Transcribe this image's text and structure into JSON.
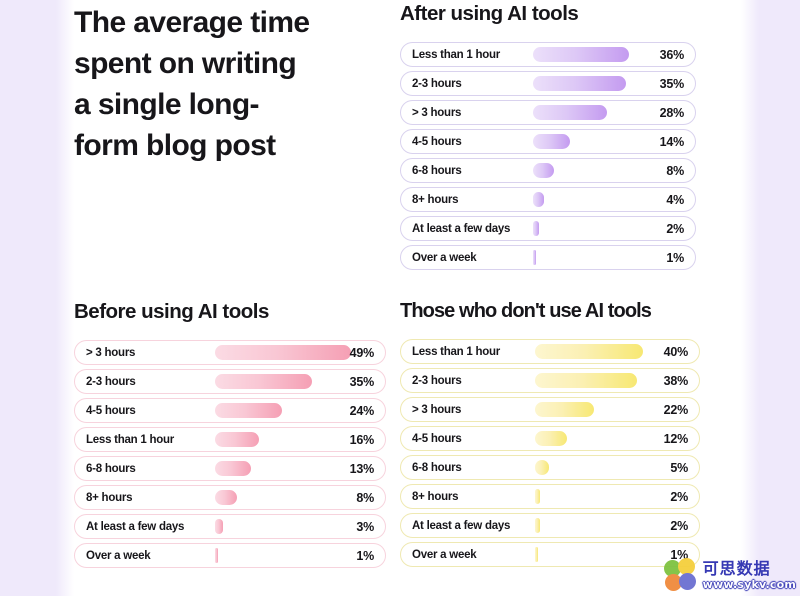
{
  "headline": "The average time spent on writing a single long-form blog post",
  "headline_lines": "The average time\nspent on writing\na single long-\nform blog post",
  "colors": {
    "purple_accent": "#c49bf0",
    "pink_accent": "#f59fb4",
    "yellow_accent": "#f7e873",
    "page_background": "#ffffff",
    "gutter_background": "#efe9fb",
    "text": "#17161a"
  },
  "sections": {
    "after": {
      "title": "After using AI tools",
      "color": "purple"
    },
    "before": {
      "title": "Before using AI tools",
      "color": "pink"
    },
    "non_users": {
      "title": "Those who don't use AI tools",
      "color": "yellow"
    }
  },
  "watermark": {
    "cn": "可思数据",
    "url": "www.sykv.com"
  },
  "chart_data": [
    {
      "type": "bar",
      "title": "After using AI tools",
      "orientation": "horizontal",
      "series_color": "#c49bf0",
      "xlabel": "",
      "ylabel": "",
      "xlim": [
        0,
        100
      ],
      "unit": "%",
      "grid": false,
      "legend": "none",
      "categories": [
        "Less than 1 hour",
        "2-3 hours",
        "> 3 hours",
        "4-5 hours",
        "6-8 hours",
        "8+ hours",
        "At least a few days",
        "Over a week"
      ],
      "values": [
        36,
        35,
        28,
        14,
        8,
        4,
        2,
        1
      ],
      "labels": [
        "36%",
        "35%",
        "28%",
        "14%",
        "8%",
        "4%",
        "2%",
        "1%"
      ]
    },
    {
      "type": "bar",
      "title": "Before using AI tools",
      "orientation": "horizontal",
      "series_color": "#f59fb4",
      "xlabel": "",
      "ylabel": "",
      "xlim": [
        0,
        100
      ],
      "unit": "%",
      "grid": false,
      "legend": "none",
      "categories": [
        "> 3 hours",
        "2-3 hours",
        "4-5 hours",
        "Less than 1 hour",
        "6-8 hours",
        "8+ hours",
        "At least a few days",
        "Over a week"
      ],
      "values": [
        49,
        35,
        24,
        16,
        13,
        8,
        3,
        1
      ],
      "labels": [
        "49%",
        "35%",
        "24%",
        "16%",
        "13%",
        "8%",
        "3%",
        "1%"
      ]
    },
    {
      "type": "bar",
      "title": "Those who don't use AI tools",
      "orientation": "horizontal",
      "series_color": "#f7e873",
      "xlabel": "",
      "ylabel": "",
      "xlim": [
        0,
        100
      ],
      "unit": "%",
      "grid": false,
      "legend": "none",
      "categories": [
        "Less than 1 hour",
        "2-3 hours",
        "> 3 hours",
        "4-5 hours",
        "6-8 hours",
        "8+ hours",
        "At least a few days",
        "Over a week"
      ],
      "values": [
        40,
        38,
        22,
        12,
        5,
        2,
        2,
        1
      ],
      "labels": [
        "40%",
        "38%",
        "22%",
        "12%",
        "5%",
        "2%",
        "2%",
        "1%"
      ]
    }
  ]
}
